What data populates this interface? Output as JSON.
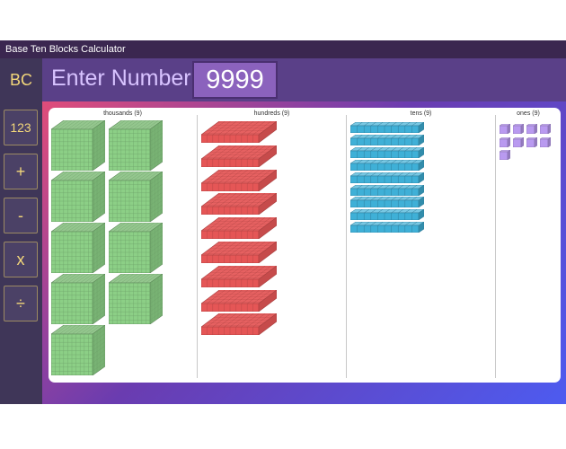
{
  "app": {
    "title": "Base Ten Blocks Calculator",
    "logo": "BC",
    "input_label": "Enter Number",
    "input_value": "9999"
  },
  "sidebar": {
    "buttons": [
      {
        "label": "123",
        "name": "number-mode-button"
      },
      {
        "label": "+",
        "name": "add-button"
      },
      {
        "label": "-",
        "name": "subtract-button"
      },
      {
        "label": "x",
        "name": "multiply-button"
      },
      {
        "label": "÷",
        "name": "divide-button"
      }
    ]
  },
  "columns": [
    {
      "label": "thousands",
      "count": 9,
      "count_text": "(9)",
      "block": "cube"
    },
    {
      "label": "hundreds",
      "count": 9,
      "count_text": "(9)",
      "block": "flat"
    },
    {
      "label": "tens",
      "count": 9,
      "count_text": "(9)",
      "block": "rod"
    },
    {
      "label": "ones",
      "count": 9,
      "count_text": "(9)",
      "block": "unit"
    }
  ],
  "colors": {
    "thousands": "#8ccf86",
    "hundreds": "#f15b5b",
    "tens": "#3fb0d7",
    "ones": "#b99af0",
    "accent": "#f3d77a"
  }
}
